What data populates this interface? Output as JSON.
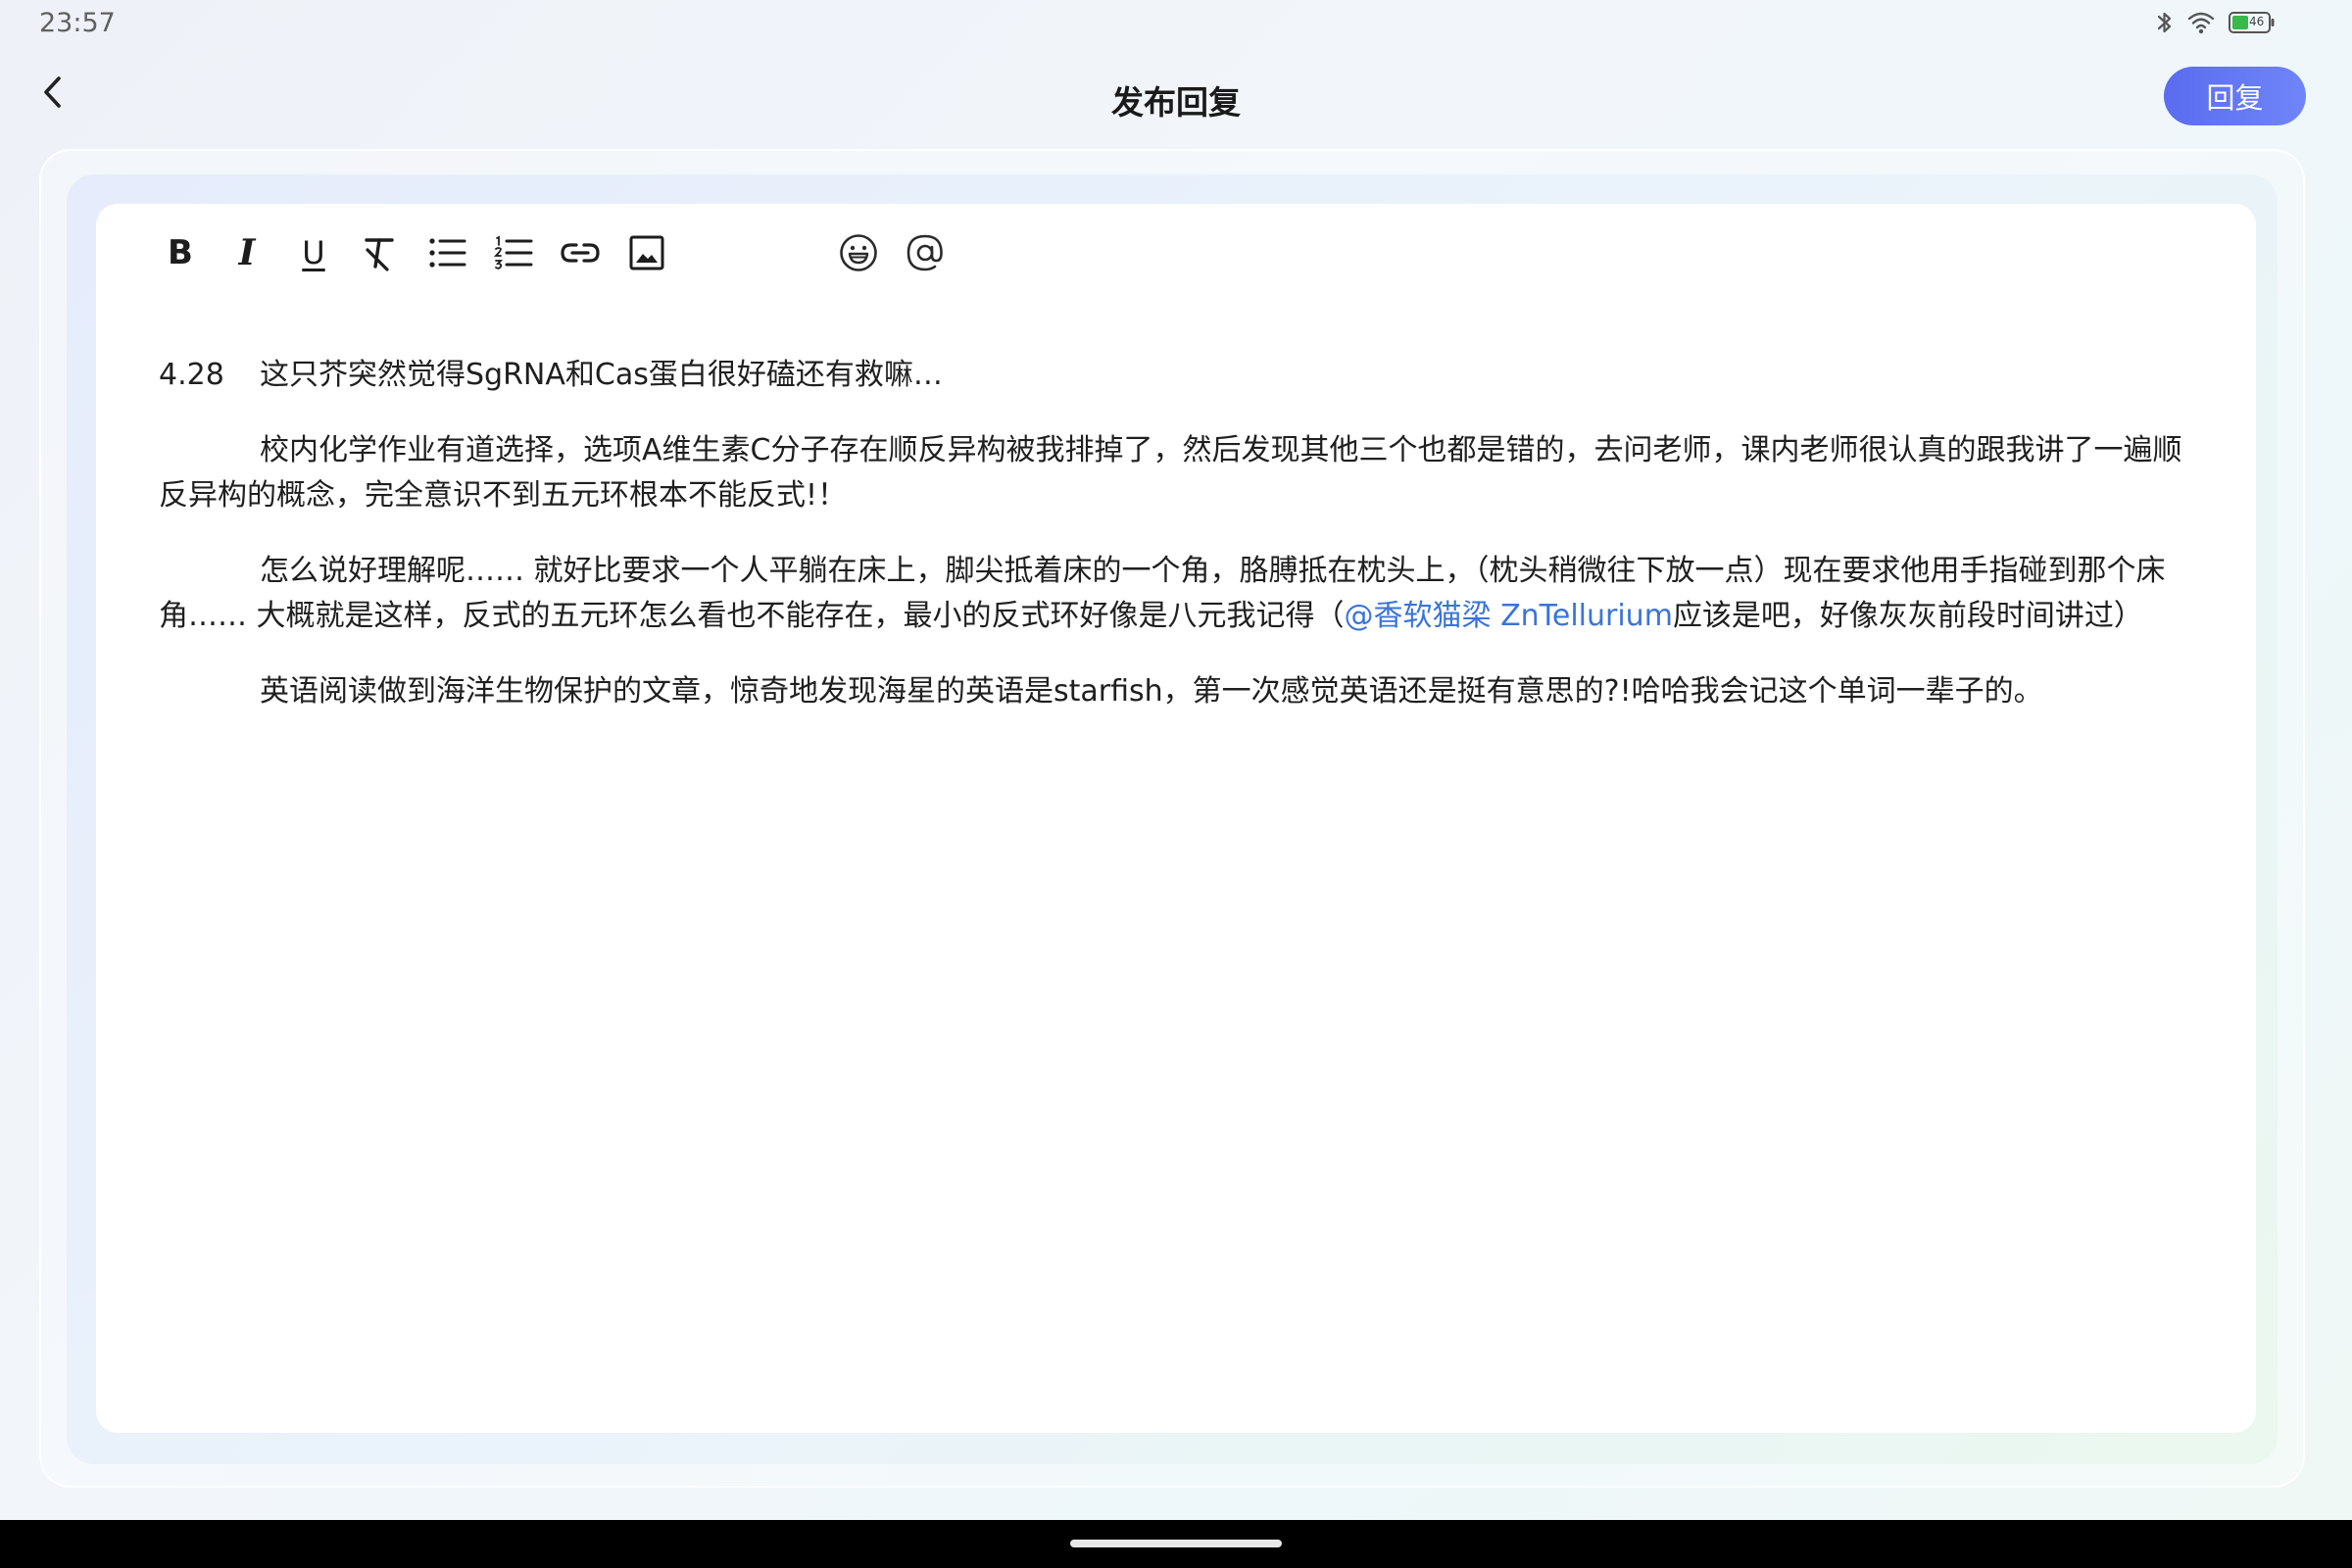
{
  "status_bar": {
    "time": "23:57",
    "battery_level": "46",
    "icons": [
      "bluetooth-icon",
      "wifi-icon",
      "battery-icon"
    ]
  },
  "header": {
    "title": "发布回复",
    "reply_button_label": "回复",
    "back_icon": "chevron-left-icon"
  },
  "toolbar": {
    "tools": [
      "bold",
      "italic",
      "underline",
      "clear-format",
      "bullet-list",
      "numbered-list",
      "link",
      "image",
      "emoji",
      "mention"
    ],
    "bold_glyph": "B",
    "italic_glyph": "I",
    "underline_glyph": "U"
  },
  "content": {
    "p1_date": "4.28",
    "p1_text": "这只芥突然觉得SgRNA和Cas蛋白很好磕还有救嘛…",
    "p2_text": "校内化学作业有道选择，选项A维生素C分子存在顺反异构被我排掉了，然后发现其他三个也都是错的，去问老师，课内老师很认真的跟我讲了一遍顺反异构的概念，完全意识不到五元环根本不能反式!！",
    "p3_text_before": "怎么说好理解呢…… 就好比要求一个人平躺在床上，脚尖抵着床的一个角，胳膊抵在枕头上，（枕头稍微往下放一点）现在要求他用手指碰到那个床角…… 大概就是这样，反式的五元环怎么看也不能存在，最小的反式环好像是八元我记得（",
    "p3_mention": "@香软猫梁 ZnTellurium",
    "p3_text_after": "应该是吧，好像灰灰前段时间讲过）",
    "p4_text": "英语阅读做到海洋生物保护的文章，惊奇地发现海星的英语是starfish，第一次感觉英语还是挺有意思的?!哈哈我会记这个单词一辈子的。"
  },
  "colors": {
    "accent": "#6272f2",
    "mention": "#3a74d8",
    "text": "#1f1f1f"
  }
}
